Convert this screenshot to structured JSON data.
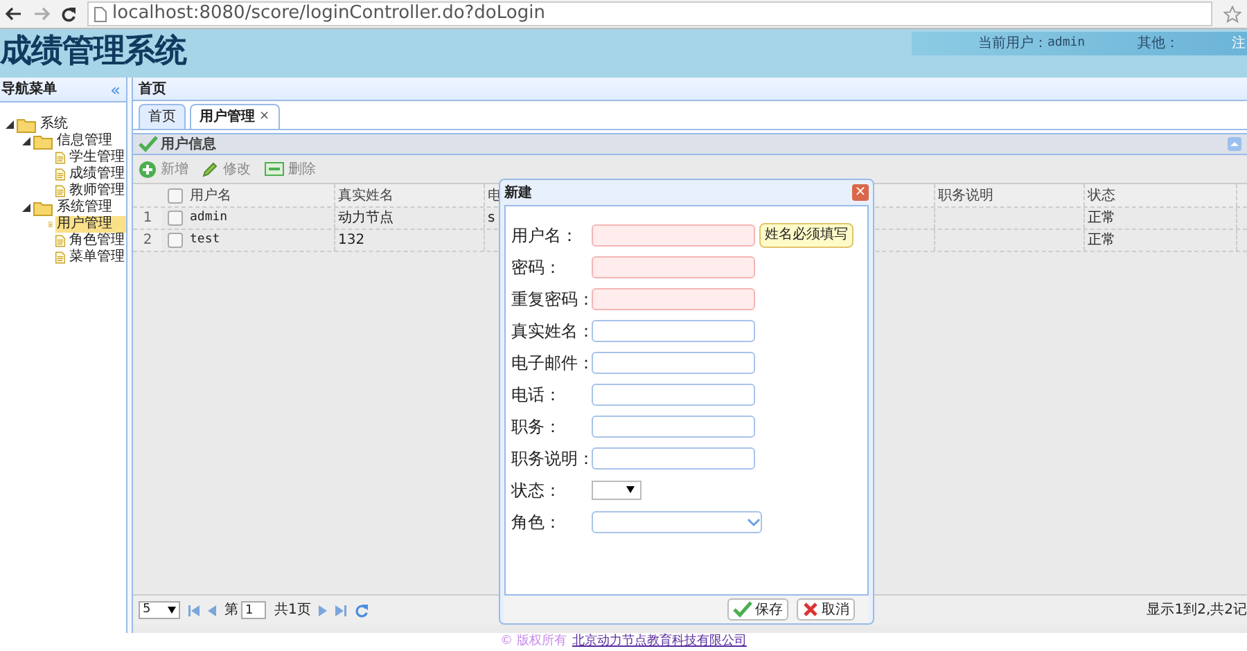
{
  "browser": {
    "url": "localhost:8080/score/loginController.do?doLogin"
  },
  "header": {
    "title": "成绩管理系统",
    "user_label": "当前用户：",
    "user": "admin",
    "other_label": "其他：",
    "cut_text": "注"
  },
  "sidebar": {
    "title": "导航菜单",
    "collapse": "«",
    "tree": [
      {
        "label": "系统",
        "expanded": true,
        "selected": false,
        "children": [
          {
            "label": "信息管理",
            "expanded": true,
            "selected": false,
            "children": [
              {
                "label": "学生管理",
                "selected": false
              },
              {
                "label": "成绩管理",
                "selected": false
              },
              {
                "label": "教师管理",
                "selected": false
              }
            ]
          },
          {
            "label": "系统管理",
            "expanded": true,
            "selected": false,
            "children": [
              {
                "label": "用户管理",
                "selected": true
              },
              {
                "label": "角色管理",
                "selected": false
              },
              {
                "label": "菜单管理",
                "selected": false
              }
            ]
          }
        ]
      }
    ]
  },
  "breadcrumb": "首页",
  "tabs": [
    {
      "label": "首页",
      "selected": false,
      "closable": false
    },
    {
      "label": "用户管理",
      "selected": true,
      "closable": true,
      "close": "×"
    }
  ],
  "panel": {
    "title": "用户信息",
    "toolbar": [
      {
        "kind": "add",
        "label": "新增"
      },
      {
        "kind": "edit",
        "label": "修改"
      },
      {
        "kind": "delete",
        "label": "删除"
      }
    ]
  },
  "table": {
    "all_checked": false,
    "columns": [
      "用户名",
      "真实姓名",
      "电",
      "职务说明",
      "状态"
    ],
    "rows": [
      {
        "index": "1",
        "checked": false,
        "cells": [
          "admin",
          "动力节点",
          "s",
          "",
          "正常"
        ]
      },
      {
        "index": "2",
        "checked": false,
        "cells": [
          "test",
          "132",
          "",
          "",
          "正常"
        ]
      }
    ]
  },
  "pager": {
    "page_size": "5",
    "page_label": "第",
    "page": "1",
    "total": "共1页",
    "summary": "显示1到2,共2记"
  },
  "dialog": {
    "title": "新建",
    "close": "×",
    "tooltip": "姓名必须填写",
    "fields": [
      {
        "label": "用户名：",
        "kind": "input",
        "invalid": true
      },
      {
        "label": "密码：",
        "kind": "input",
        "invalid": true
      },
      {
        "label": "重复密码：",
        "kind": "input",
        "invalid": true
      },
      {
        "label": "真实姓名：",
        "kind": "input",
        "invalid": false
      },
      {
        "label": "电子邮件：",
        "kind": "input",
        "invalid": false
      },
      {
        "label": "电话：",
        "kind": "input",
        "invalid": false
      },
      {
        "label": "职务：",
        "kind": "input",
        "invalid": false
      },
      {
        "label": "职务说明：",
        "kind": "input",
        "invalid": false
      },
      {
        "label": "状态：",
        "kind": "select",
        "invalid": false
      },
      {
        "label": "角色：",
        "kind": "combo",
        "invalid": false
      }
    ],
    "buttons": [
      {
        "kind": "save",
        "label": "保存"
      },
      {
        "kind": "cancel",
        "label": "取消"
      }
    ]
  },
  "footer": {
    "copyright": "© 版权所有",
    "company": "北京动力节点教育科技有限公司"
  }
}
